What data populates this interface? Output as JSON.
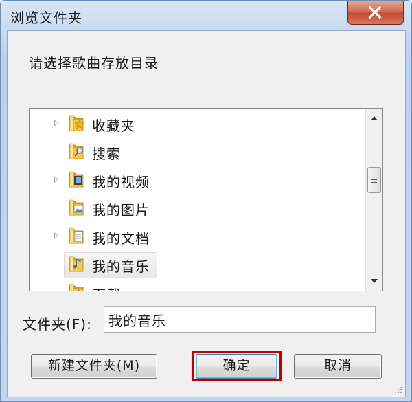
{
  "window": {
    "title": "浏览文件夹",
    "close_symbol": "✕"
  },
  "prompt": "请选择歌曲存放目录",
  "tree": {
    "items": [
      {
        "label": "收藏夹",
        "icon": "favorites-folder-icon",
        "expandable": true,
        "selected": false
      },
      {
        "label": "搜索",
        "icon": "search-folder-icon",
        "expandable": false,
        "selected": false
      },
      {
        "label": "我的视频",
        "icon": "videos-folder-icon",
        "expandable": true,
        "selected": false
      },
      {
        "label": "我的图片",
        "icon": "pictures-folder-icon",
        "expandable": false,
        "selected": false
      },
      {
        "label": "我的文档",
        "icon": "documents-folder-icon",
        "expandable": true,
        "selected": false
      },
      {
        "label": "我的音乐",
        "icon": "music-folder-icon",
        "expandable": false,
        "selected": true
      },
      {
        "label": "下载",
        "icon": "downloads-folder-icon",
        "expandable": false,
        "selected": false
      }
    ]
  },
  "folder_field": {
    "label": "文件夹(F):",
    "value": "我的音乐"
  },
  "buttons": {
    "new_folder": "新建文件夹(M)",
    "ok": "确定",
    "cancel": "取消"
  },
  "colors": {
    "highlight_border": "#c00000",
    "folder_yellow": "#f5c94a"
  }
}
